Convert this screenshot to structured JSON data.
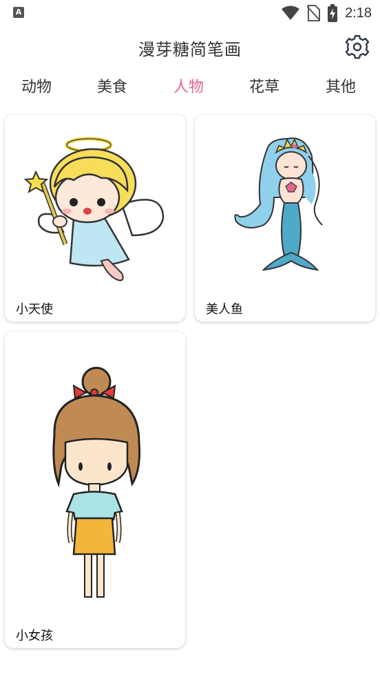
{
  "status_bar": {
    "time": "2:18",
    "app_icon": "A"
  },
  "header": {
    "title": "漫芽糖简笔画",
    "settings_icon": "gear-icon"
  },
  "tabs": [
    {
      "label": "动物",
      "active": false
    },
    {
      "label": "美食",
      "active": false
    },
    {
      "label": "人物",
      "active": true
    },
    {
      "label": "花草",
      "active": false
    },
    {
      "label": "其他",
      "active": false
    }
  ],
  "colors": {
    "accent": "#e4658f",
    "text": "#333333"
  },
  "cards": [
    {
      "label": "小天使"
    },
    {
      "label": "美人鱼"
    },
    {
      "label": "小女孩"
    }
  ]
}
